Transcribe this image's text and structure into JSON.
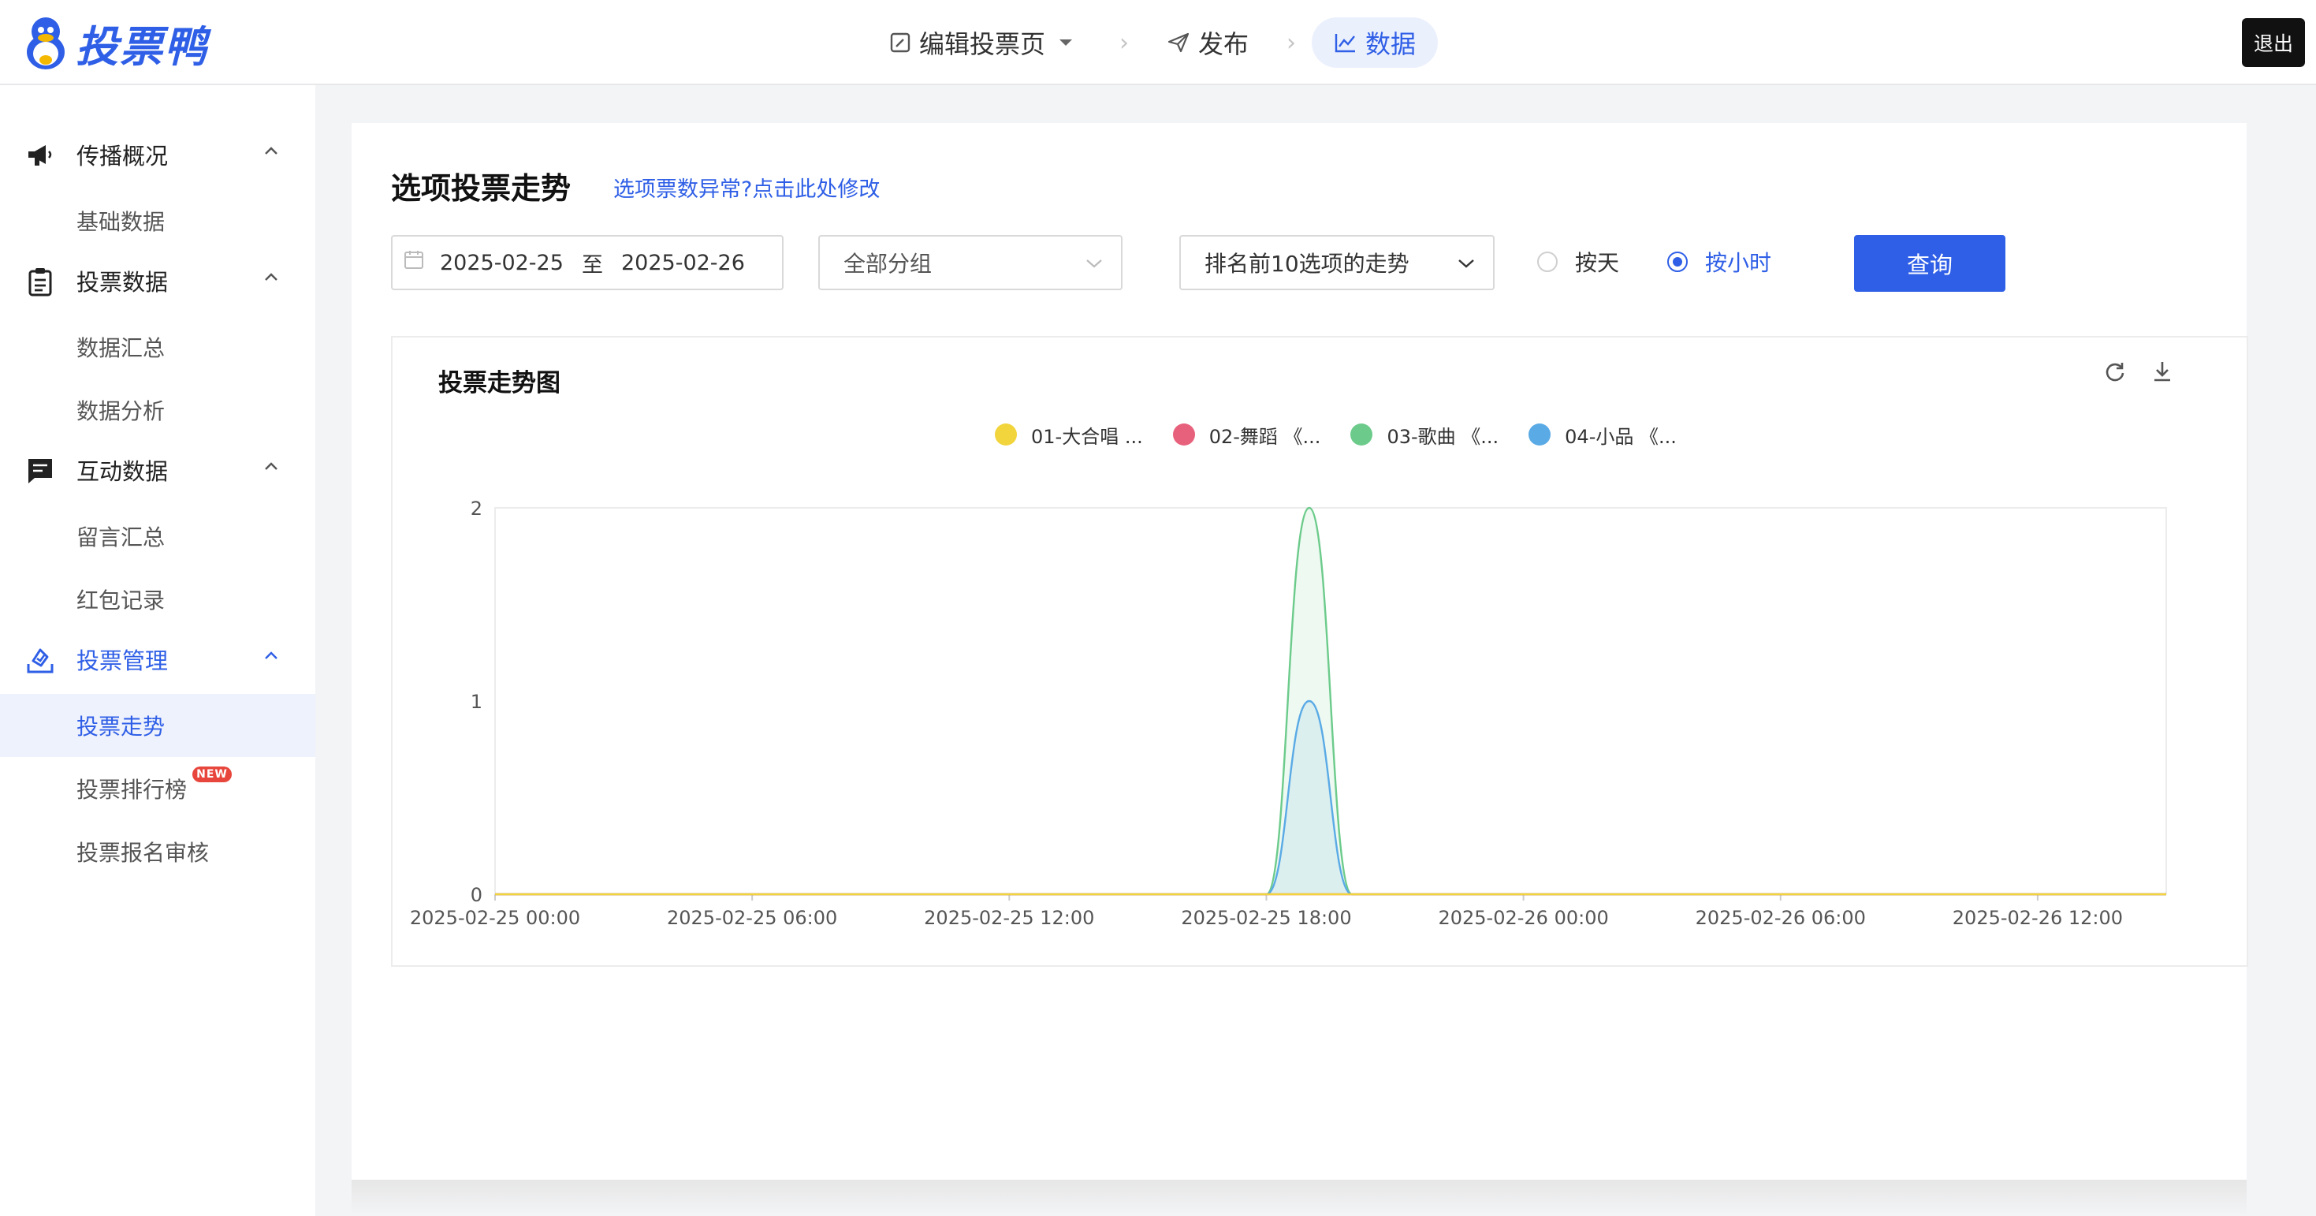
{
  "app": {
    "logo_text": "投票鸭"
  },
  "topnav": {
    "edit": "编辑投票页",
    "publish": "发布",
    "data": "数据"
  },
  "logout": "退出",
  "sidebar": {
    "groups": [
      {
        "label": "传播概况",
        "icon": "megaphone-icon",
        "items": [
          "基础数据"
        ]
      },
      {
        "label": "投票数据",
        "icon": "clipboard-icon",
        "items": [
          "数据汇总",
          "数据分析"
        ]
      },
      {
        "label": "互动数据",
        "icon": "chat-icon",
        "items": [
          "留言汇总",
          "红包记录"
        ]
      },
      {
        "label": "投票管理",
        "icon": "ballot-icon",
        "items": [
          "投票走势",
          "投票排行榜",
          "投票报名审核"
        ]
      }
    ],
    "new_badge": "NEW",
    "active_item": "投票走势"
  },
  "main": {
    "title": "选项投票走势",
    "fix_link": "选项票数异常?点击此处修改",
    "date_start": "2025-02-25",
    "date_to": "至",
    "date_end": "2025-02-26",
    "group_select": "全部分组",
    "rank_select": "排名前10选项的走势",
    "radio_day": "按天",
    "radio_hour": "按小时",
    "radio_selected": "按小时",
    "query_button": "查询"
  },
  "chart_data": {
    "type": "area",
    "title": "投票走势图",
    "series": [
      {
        "name": "01-大合唱 ...",
        "color": "#f2d43d",
        "values": [
          0,
          0,
          0,
          0,
          0,
          0,
          0,
          0,
          0,
          0,
          0,
          0,
          0,
          0,
          0,
          0,
          0,
          0,
          0,
          0,
          0,
          0,
          0,
          0,
          0,
          0,
          0,
          0,
          0,
          0,
          0,
          0,
          0,
          0,
          0,
          0,
          0,
          0,
          0,
          0
        ]
      },
      {
        "name": "02-舞蹈 《...",
        "color": "#e8617c",
        "values": [
          0,
          0,
          0,
          0,
          0,
          0,
          0,
          0,
          0,
          0,
          0,
          0,
          0,
          0,
          0,
          0,
          0,
          0,
          0,
          0,
          0,
          0,
          0,
          0,
          0,
          0,
          0,
          0,
          0,
          0,
          0,
          0,
          0,
          0,
          0,
          0,
          0,
          0,
          0,
          0
        ]
      },
      {
        "name": "03-歌曲 《...",
        "color": "#6ccb8b",
        "values": [
          0,
          0,
          0,
          0,
          0,
          0,
          0,
          0,
          0,
          0,
          0,
          0,
          0,
          0,
          0,
          0,
          0,
          0,
          0,
          2,
          0,
          0,
          0,
          0,
          0,
          0,
          0,
          0,
          0,
          0,
          0,
          0,
          0,
          0,
          0,
          0,
          0,
          0,
          0,
          0
        ]
      },
      {
        "name": "04-小品 《...",
        "color": "#5aaae6",
        "values": [
          0,
          0,
          0,
          0,
          0,
          0,
          0,
          0,
          0,
          0,
          0,
          0,
          0,
          0,
          0,
          0,
          0,
          0,
          0,
          1,
          0,
          0,
          0,
          0,
          0,
          0,
          0,
          0,
          0,
          0,
          0,
          0,
          0,
          0,
          0,
          0,
          0,
          0,
          0,
          0
        ]
      }
    ],
    "x_start": "2025-02-25 00:00",
    "x_step_hours": 1,
    "x_tick_labels": [
      "2025-02-25 00:00",
      "2025-02-25 06:00",
      "2025-02-25 12:00",
      "2025-02-25 18:00",
      "2025-02-26 00:00",
      "2025-02-26 06:00",
      "2025-02-26 12:00"
    ],
    "y_ticks": [
      0,
      1,
      2
    ],
    "ylim": [
      0,
      2
    ],
    "legend_position": "top-center",
    "grid": false
  }
}
